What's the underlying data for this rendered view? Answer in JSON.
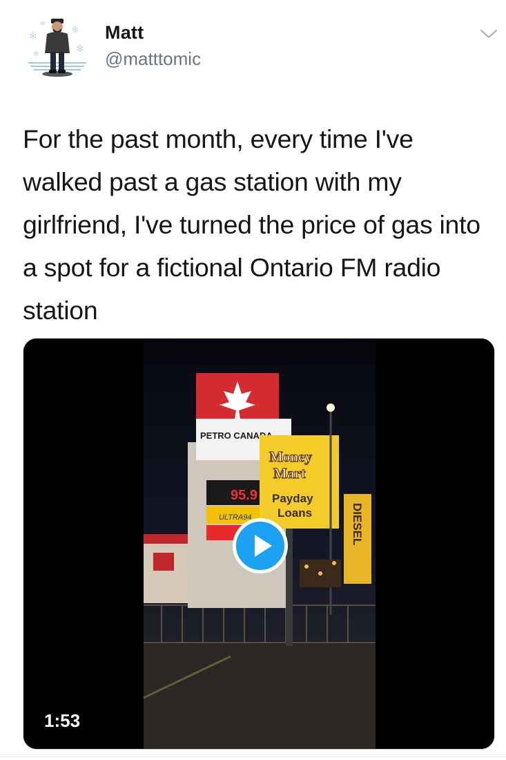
{
  "tweet": {
    "author_name": "Matt",
    "author_handle": "@matttomic",
    "text": "For the past month, every time I've walked past a gas station with my girlfriend, I've turned the price of gas into a spot for a fictional Ontario FM radio station"
  },
  "media": {
    "duration": "1:53",
    "sign_texts": {
      "brand": "PETRO CANADA",
      "price": "95.9",
      "grade": "ULTRA94",
      "money": "Money",
      "mart": "Mart",
      "payday": "Payday",
      "loans": "Loans",
      "diesel": "DIESEL"
    }
  },
  "icons": {
    "caret": "chevron-down-icon",
    "play": "play-icon"
  },
  "colors": {
    "accent": "#1da1f2",
    "handle": "#657786",
    "text": "#14171a"
  }
}
